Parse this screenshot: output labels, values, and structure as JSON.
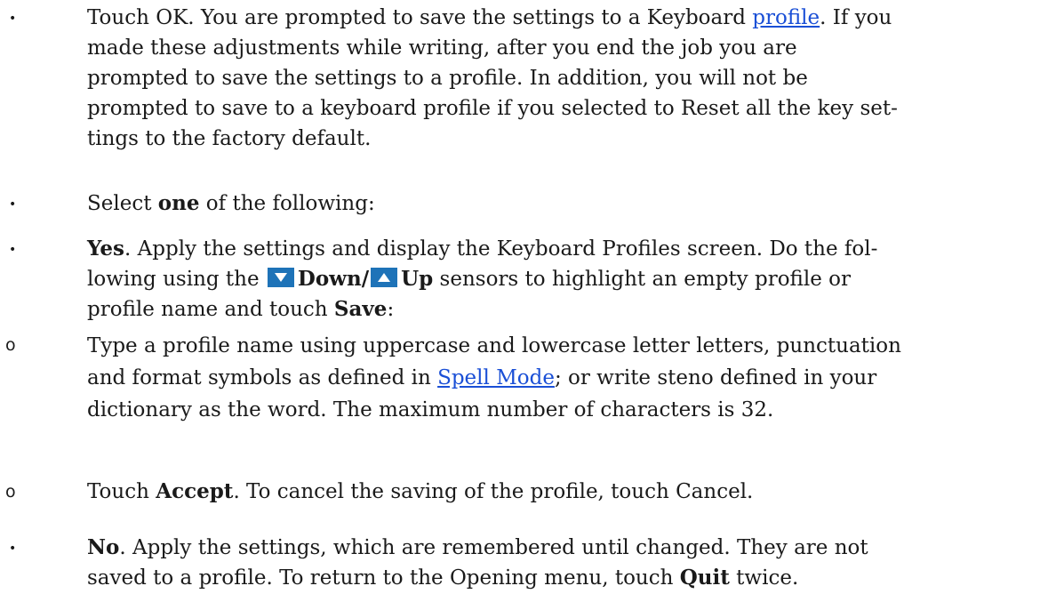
{
  "markers": {
    "bullet": "•",
    "sub_bullet": "o"
  },
  "items": [
    {
      "lines": [
        {
          "a": "Touch OK. You are prompted to save the settings to a Keyboard ",
          "link": "profile",
          "b": ". If you"
        },
        {
          "text": "made these adjustments while writing, after you end the job you are"
        },
        {
          "text": "prompted to save the settings to a profile. In addition, you will not be"
        },
        {
          "text": "prompted to save to a keyboard profile if you selected to Reset all the key set-"
        },
        {
          "text": "tings to the factory default."
        }
      ]
    },
    {
      "a": "Select ",
      "bold": "one",
      "b": " of the following:"
    },
    {
      "line1": {
        "bold": "Yes",
        "rest": ". Apply the settings and display the Keyboard Profiles screen. Do the fol-"
      },
      "line2": {
        "a": "lowing using the ",
        "down_label": "Down/",
        "up_label": "Up",
        "b": " sensors to highlight an empty profile or"
      },
      "line3": {
        "a": "profile name and touch ",
        "bold": "Save",
        "b": ":"
      }
    },
    {
      "line1": {
        "text": "Type a profile name using uppercase and lowercase letter letters, punctuation"
      },
      "line2": {
        "a": "and format symbols as defined in ",
        "link": "Spell Mode",
        "b": "; or write steno defined in your"
      },
      "line3": {
        "text": "dictionary as the word. The maximum number of characters is 32."
      }
    },
    {
      "a": "Touch ",
      "bold": "Accept",
      "b": ". To cancel the saving of the profile, touch Cancel."
    },
    {
      "line1": {
        "bold": "No",
        "rest": ". Apply the settings, which are remembered until changed. They are not"
      },
      "line2": {
        "a": "saved to a profile. To return to the Opening menu, touch ",
        "bold": "Quit",
        "b": " twice."
      }
    }
  ],
  "icons": {
    "down": "down-arrow-sensor-icon",
    "up": "up-arrow-sensor-icon"
  },
  "colors": {
    "link": "#1a4fd6",
    "sensor_bg": "#1e73b8",
    "text": "#1a1a1a"
  }
}
